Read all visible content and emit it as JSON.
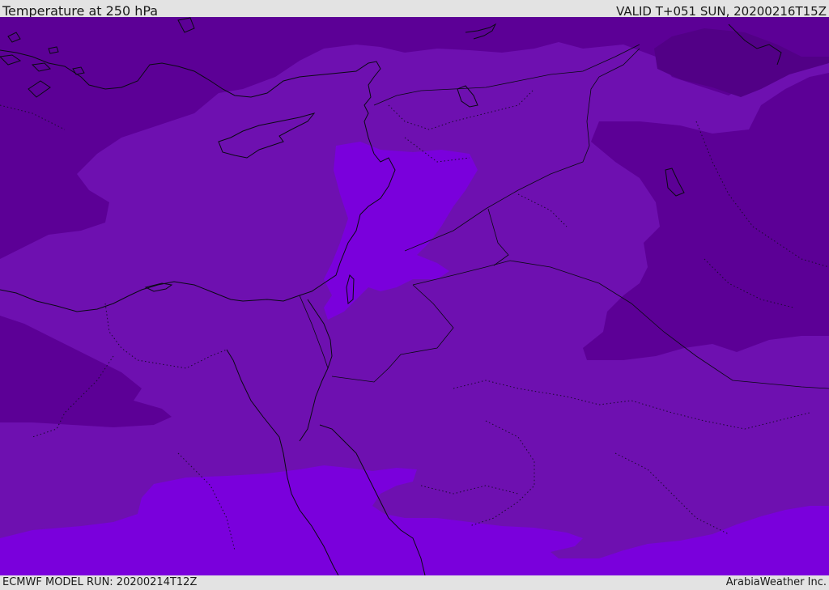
{
  "header": {
    "title": "Temperature at 250 hPa",
    "valid": "VALID T+051 SUN, 20200216T15Z"
  },
  "footer": {
    "model_run": "ECMWF MODEL RUN: 20200214T12Z",
    "credit": "ArabiaWeather Inc."
  },
  "colors": {
    "dark_purple": "#5c0096",
    "mid_purple": "#6e10b0",
    "light_purple": "#7a00dc",
    "coastline": "#0a0a14"
  }
}
